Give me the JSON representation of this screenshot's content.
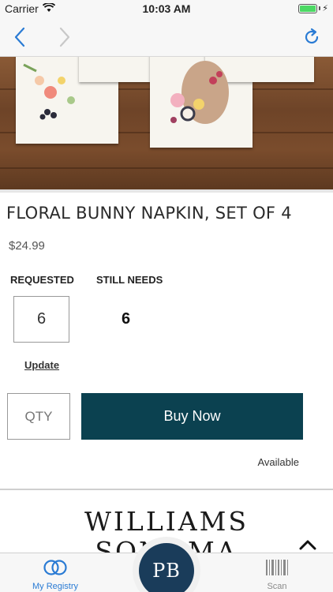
{
  "status_bar": {
    "carrier": "Carrier",
    "time": "10:03 AM",
    "battery_level": 1.0
  },
  "nav": {
    "back_icon": "chevron-left-icon",
    "forward_icon": "chevron-right-icon",
    "refresh_icon": "refresh-icon"
  },
  "product": {
    "title": "FLORAL BUNNY NAPKIN, SET OF 4",
    "price": "$24.99",
    "requested_label": "REQUESTED",
    "still_needs_label": "STILL NEEDS",
    "requested_value": "6",
    "still_needs_value": "6",
    "update_label": "Update",
    "qty_placeholder": "QTY",
    "buy_label": "Buy Now",
    "availability": "Available"
  },
  "brand": {
    "line1": "WILLIAMS",
    "line2": "SONOMA"
  },
  "tab_bar": {
    "registry_label": "My Registry",
    "center_logo": "PB",
    "scan_label": "Scan"
  },
  "colors": {
    "accent": "#2a7bd4",
    "buy_button": "#0b4150",
    "center_logo_bg": "#1a3c5a"
  }
}
